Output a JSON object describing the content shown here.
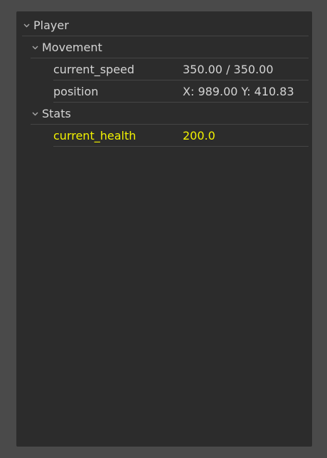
{
  "tree": {
    "root": {
      "label": "Player",
      "expanded_icon": "chevron-down-icon"
    },
    "groups": [
      {
        "label": "Movement",
        "properties": [
          {
            "key": "current_speed",
            "value": "350.00 / 350.00"
          },
          {
            "key": "position",
            "value": "X: 989.00 Y: 410.83"
          }
        ]
      },
      {
        "label": "Stats",
        "properties": [
          {
            "key": "current_health",
            "value": "200.0"
          }
        ]
      }
    ]
  },
  "colors": {
    "background": "#4a4a4a",
    "panel": "#2c2c2c",
    "text": "#d4d4d4",
    "highlight": "#f2f200",
    "separator": "#454545"
  }
}
